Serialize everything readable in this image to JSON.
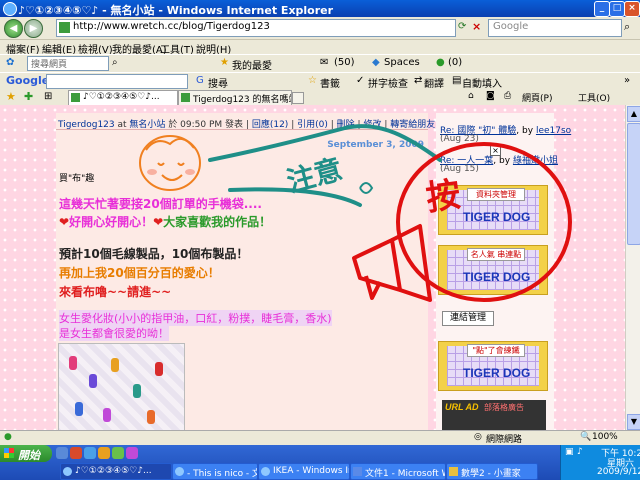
{
  "window": {
    "title": "♪♡①②③④⑤♡♪ - 無名小站 - Windows Internet Explorer",
    "minimize": "_",
    "maximize": "□",
    "close": "×"
  },
  "address": {
    "url": "http://www.wretch.cc/blog/Tigerdog123",
    "search_placeholder": "Google"
  },
  "menu": {
    "items": [
      "檔案(F)",
      "編輯(E)",
      "檢視(V)",
      "我的最愛(A)",
      "工具(T)",
      "說明(H)"
    ]
  },
  "bing_bar": {
    "search_placeholder": "搜尋網頁",
    "favorites": "我的最愛",
    "mail_count": "(50)",
    "spaces": "Spaces",
    "msg_count": "(0)"
  },
  "google_bar": {
    "logo": "Google",
    "search_label": "搜尋",
    "bookmarks": "書籤",
    "spellcheck": "拼字檢查",
    "translate": "翻譯",
    "autofill": "自動填入"
  },
  "tabs": {
    "tab1": "♪♡①②③④⑤♡♪...",
    "tab2": "Tigerdog123 的無名嗎站 -...",
    "page_menu": "網頁(P)",
    "tools_menu": "工具(O)"
  },
  "post": {
    "meta": {
      "author": "Tigerdog123",
      "at": "at",
      "site": "無名小站",
      "time": "於 09:50 PM 發表",
      "sep": "|",
      "reply": "回應(12)",
      "trackback": "引用(0)",
      "delete": "刪除",
      "edit": "修改",
      "forward": "轉寄給朋友",
      "report": "檢舉"
    },
    "date": "September 3, 2009",
    "heading": "買\"布\"趣",
    "line1": "這幾天忙著要接20個訂單的手機袋....",
    "line2a": "好開心好開心！",
    "line2b": "大家喜歡我的作品！",
    "line3": "預計10個毛線製品，10個布製品！",
    "line4": "再加上我20個百分百的愛心！",
    "line5": "來看布嚕~~請進~~",
    "line6": "女生愛化妝(小小的指甲油，口紅，粉撲，睫毛膏，香水)",
    "line7": "是女生都會很愛的呦！"
  },
  "sidebar": {
    "comment1_link": "Re: 國際 \"初\" 體驗",
    "comment1_by": "by",
    "comment1_user": "lee17so",
    "comment1_date": "(Aug 23)",
    "comment2_link": "Re: 一人一葉",
    "comment2_by": "by",
    "comment2_user": "綠袖嫩小姐",
    "comment2_date": "(Aug 15)",
    "banner1_label": "資料夾管理",
    "banner1_text": "TIGER DOG",
    "banner2_label": "名人氣 串連點",
    "banner2_text": "TIGER DOG",
    "link_manage": "連結管理",
    "banner3_label": "\"點\"了會練鐵",
    "banner3_text": "TIGER DOG",
    "ad_brand": "URL AD",
    "ad_text": "部落格廣告"
  },
  "annotations": {
    "notice": "注意",
    "press": "按"
  },
  "status": {
    "zone": "網際網路",
    "zoom": "100%"
  },
  "taskbar": {
    "start": "開始",
    "task1": "♪♡①②③④⑤♡♪...",
    "task2": "- This is nico - 文章...",
    "task3": "IKEA - Windows Int...",
    "task4": "文件1 - Microsoft W...",
    "task5": "數學2 - 小畫家",
    "clock_time": "下午 10:24",
    "clock_day": "星期六",
    "clock_date": "2009/9/12"
  },
  "colors": {
    "accent_blue": "#0a5fd8",
    "page_pink": "#ffd6e3",
    "annotation_red": "#e01010",
    "annotation_teal": "#1f8f88",
    "banner_yellow": "#f3d148"
  }
}
